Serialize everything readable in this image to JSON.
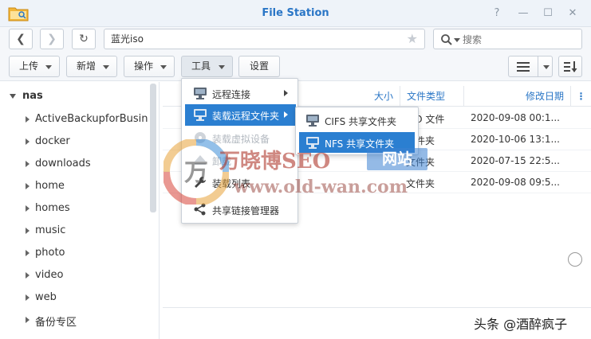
{
  "window": {
    "title": "File Station",
    "help": "?",
    "minimize": "—",
    "maximize": "☐",
    "close": "✕"
  },
  "nav": {
    "back": "❮",
    "forward": "❯",
    "refresh": "↻"
  },
  "path": {
    "value": "蓝光iso"
  },
  "search": {
    "placeholder": "搜索"
  },
  "toolbar": {
    "upload": "上传",
    "new": "新增",
    "action": "操作",
    "tools": "工具",
    "settings": "设置"
  },
  "tree": {
    "root": "nas",
    "items": [
      "ActiveBackupforBusiness",
      "docker",
      "downloads",
      "home",
      "homes",
      "music",
      "photo",
      "video",
      "web",
      "备份专区"
    ]
  },
  "columns": {
    "size": "大小",
    "type": "文件类型",
    "modified": "修改日期",
    "more": "⋮"
  },
  "files": [
    {
      "type": "ISO 文件",
      "modified": "2020-09-08 00:1..."
    },
    {
      "type": "文件夹",
      "modified": "2020-10-06 13:1..."
    },
    {
      "type": "文件夹",
      "modified": "2020-07-15 22:5..."
    },
    {
      "type": "文件夹",
      "modified": "2020-09-08 09:5..."
    }
  ],
  "tools_menu": {
    "remote_connection": "远程连接",
    "mount_remote_folder": "装载远程文件夹",
    "mount_virtual_drive": "装载虚拟设备",
    "unmount": "卸载",
    "mount_list": "装载列表",
    "shared_link_manager": "共享链接管理器"
  },
  "remote_submenu": {
    "cifs": "CIFS 共享文件夹",
    "nfs": "NFS 共享文件夹"
  },
  "watermark": {
    "logo_char": "万",
    "brand": "万晓博SEO",
    "site": "网站",
    "url": "www.old-wan.com",
    "author": "头条 @酒醉疯子"
  },
  "colors": {
    "accent": "#2a76c6",
    "menu_highlight": "#2b7fd1"
  }
}
